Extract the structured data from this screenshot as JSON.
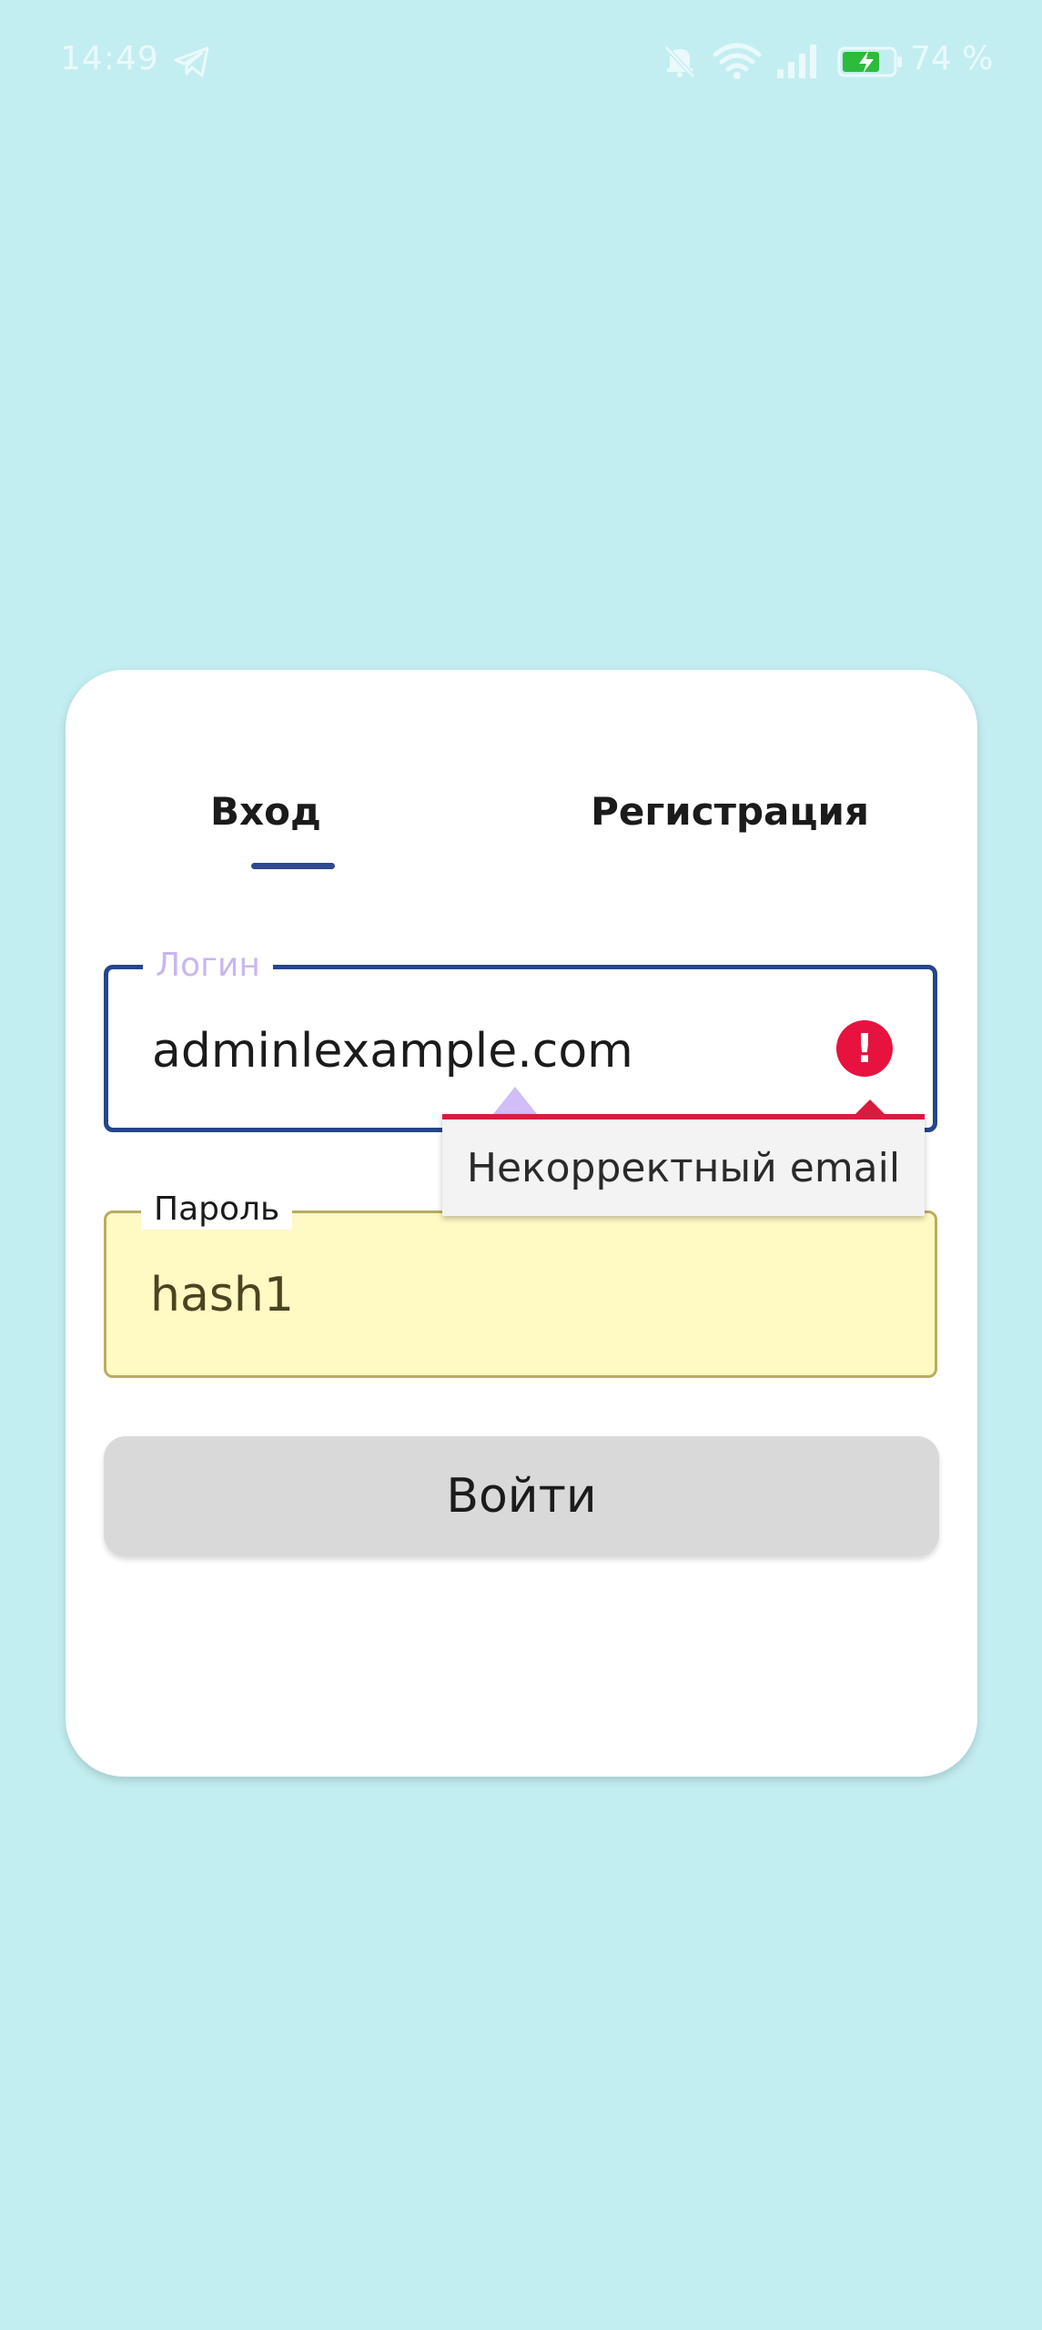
{
  "status_bar": {
    "time": "14:49",
    "battery_percent": "74 %",
    "battery_level": 0.74,
    "icons": [
      "telegram-icon",
      "bell-off-icon",
      "wifi-icon",
      "signal-icon",
      "battery-charging-icon"
    ]
  },
  "tabs": [
    {
      "label": "Вход",
      "active": true
    },
    {
      "label": "Регистрация",
      "active": false
    }
  ],
  "login_field": {
    "label": "Логин",
    "value": "adminlexample.com",
    "error_icon": "!",
    "error_message": "Некорректный email"
  },
  "password_field": {
    "label": "Пароль",
    "value": "hash1"
  },
  "submit_button": {
    "label": "Войти"
  },
  "colors": {
    "background": "#c3eef1",
    "accent": "#2e4a8e",
    "error": "#e8123f",
    "password_fill": "#fff9c4",
    "cursor_handle": "#d1bdf7"
  }
}
